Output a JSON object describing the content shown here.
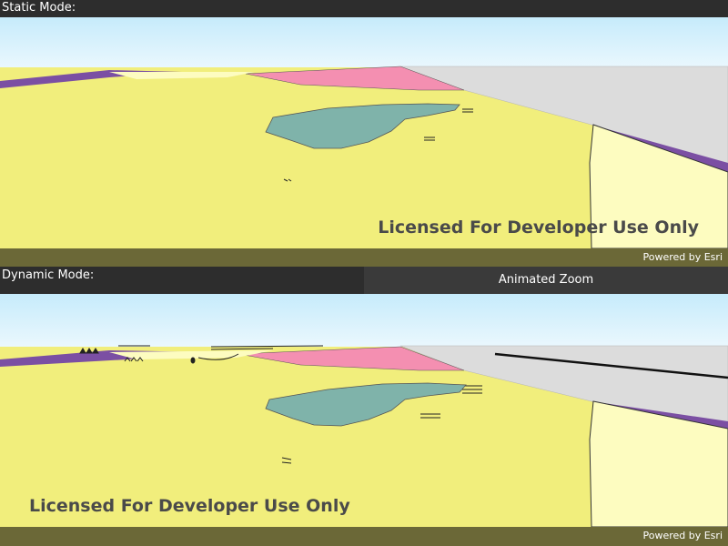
{
  "static_view": {
    "header_label": "Static Mode:",
    "watermark": "Licensed For Developer Use Only",
    "attribution": "Powered by Esri"
  },
  "dynamic_view": {
    "header_label": "Dynamic Mode:",
    "animated_zoom_button_label": "Animated Zoom",
    "watermark": "Licensed For Developer Use Only",
    "attribution": "Powered by Esri"
  },
  "colors": {
    "sky_top": "#cfeefc",
    "sky_bottom": "#e9f7fd",
    "land_yellow": "#f1ee7c",
    "water": "#7fb3aa",
    "pink_zone": "#f48fb1",
    "purple_zone": "#7b4fa3",
    "light_yellow_zone": "#fdfcc0",
    "grey_surface": "#dcdcdc",
    "attribution_bar": "#6b6837",
    "header_bg": "#2d2d2d",
    "button_bg": "#3a3a3a"
  }
}
